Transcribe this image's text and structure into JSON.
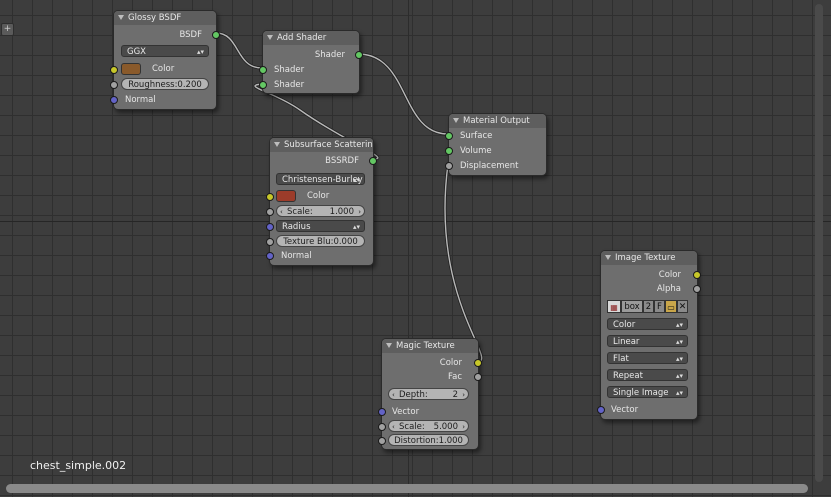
{
  "editor": {
    "tree_name": "chest_simple.002",
    "add_icon_glyph": "+"
  },
  "nodes": {
    "glossy": {
      "title": "Glossy BSDF",
      "out_bsdf": "BSDF",
      "distribution": "GGX",
      "color_label": "Color",
      "color_value": "#8a5a2b",
      "roughness": "Roughness:0.200",
      "normal": "Normal"
    },
    "add_shader": {
      "title": "Add Shader",
      "out_shader": "Shader",
      "in_shader_1": "Shader",
      "in_shader_2": "Shader"
    },
    "material_output": {
      "title": "Material Output",
      "surface": "Surface",
      "volume": "Volume",
      "displacement": "Displacement"
    },
    "sss": {
      "title": "Subsurface Scattering",
      "out_bssrdf": "BSSRDF",
      "falloff": "Christensen-Burley",
      "color_label": "Color",
      "color_value": "#9c3c2a",
      "scale_label": "Scale:",
      "scale_value": "1.000",
      "radius": "Radius",
      "texture_blur": "Texture Blu:0.000",
      "normal": "Normal"
    },
    "image_texture": {
      "title": "Image Texture",
      "out_color": "Color",
      "out_alpha": "Alpha",
      "image_name": "box",
      "users": "2",
      "fake_user": "F",
      "color_space": "Color",
      "interpolation": "Linear",
      "projection": "Flat",
      "extension": "Repeat",
      "source": "Single Image",
      "vector": "Vector"
    },
    "magic": {
      "title": "Magic Texture",
      "out_color": "Color",
      "out_fac": "Fac",
      "depth_label": "Depth:",
      "depth_value": "2",
      "vector": "Vector",
      "scale_label": "Scale:",
      "scale_value": "5.000",
      "distortion": "Distortion:1.000"
    }
  },
  "colors": {
    "socket_shader": "#63c763",
    "socket_color": "#c7c729",
    "socket_value": "#a1a1a1",
    "socket_vector": "#6363c7"
  }
}
